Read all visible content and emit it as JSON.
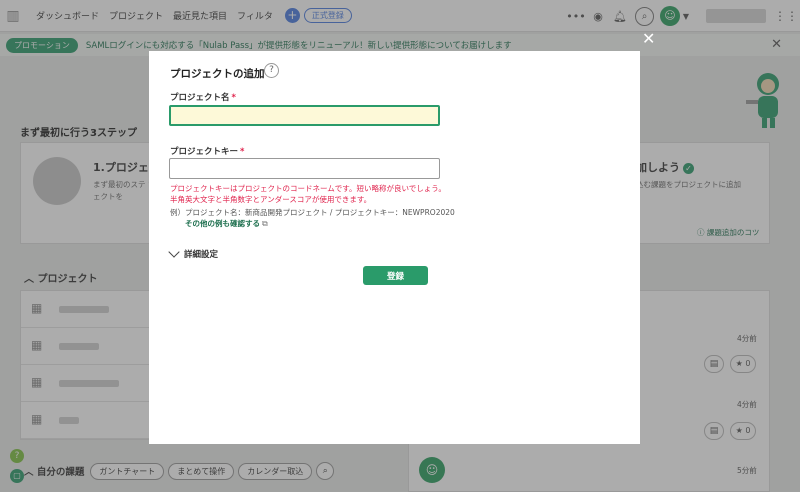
{
  "topbar": {
    "nav": [
      "ダッシュボード",
      "プロジェクト",
      "最近見た項目",
      "フィルタ"
    ],
    "trial_label": "正式登録"
  },
  "banner": {
    "tag": "プロモーション",
    "text": "SAMLログインにも対応する「Nulab Pass」が提供形態をリニューアル！新しい提供形態についてお届けします"
  },
  "dashboard": {
    "steps_title": "まず最初に行う3ステップ",
    "step1_title": "1.プロジェク",
    "step1_desc": "まず最初のステ プロジェクトを",
    "step3_title": "加しよう",
    "step3_desc": "込む課題をプロジェクトに追加",
    "tip_link": "課題追加のコツ",
    "projects_title": "プロジェクト",
    "my_issues_title": "自分の課題",
    "tools": [
      "ガントチャート",
      "まとめて操作",
      "カレンダー取込"
    ],
    "activity_times": [
      "4分前",
      "4分前",
      "5分前"
    ],
    "star_count": "0"
  },
  "modal": {
    "title": "プロジェクトの追加",
    "help": "?",
    "name_label": "プロジェクト名",
    "name_value": "",
    "key_label": "プロジェクトキー",
    "key_value": "",
    "required_mark": "*",
    "hint_line1": "プロジェクトキーはプロジェクトのコードネームです。短い略称が良いでしょう。",
    "hint_line2": "半角英大文字と半角数字とアンダースコアが使用できます。",
    "example": "例）プロジェクト名：新商品開発プロジェクト / プロジェクトキー：NEWPRO2020",
    "example_link": "その他の例も確認する",
    "advanced_label": "詳細設定",
    "submit_label": "登録"
  },
  "colors": {
    "brand_green": "#2a9b6a",
    "required_red": "#e0254e",
    "input_focus_bg": "#fdf9d8"
  }
}
